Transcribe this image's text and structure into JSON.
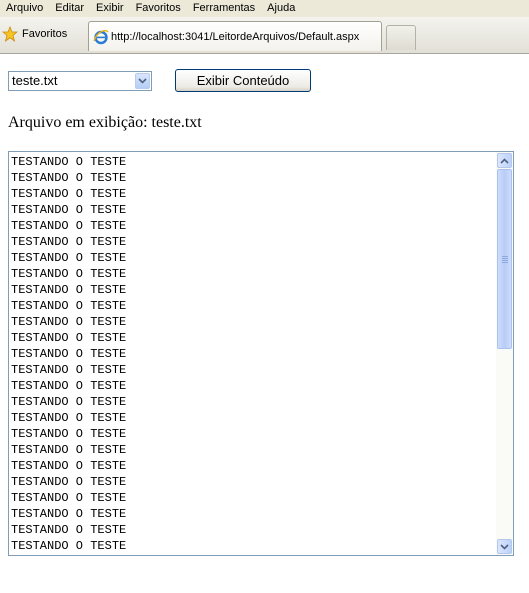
{
  "menu": [
    "Arquivo",
    "Editar",
    "Exibir",
    "Favoritos",
    "Ferramentas",
    "Ajuda"
  ],
  "favorites_label": "Favoritos",
  "tab": {
    "title": "http://localhost:3041/LeitordeArquivos/Default.aspx"
  },
  "file_select": {
    "value": "teste.txt"
  },
  "show_button": {
    "label": "Exibir Conteúdo"
  },
  "current_file": {
    "label": "Arquivo em exibição:",
    "name": "teste.txt"
  },
  "content_lines": [
    "TESTANDO O TESTE",
    "TESTANDO O TESTE",
    "TESTANDO O TESTE",
    "TESTANDO O TESTE",
    "TESTANDO O TESTE",
    "TESTANDO O TESTE",
    "TESTANDO O TESTE",
    "TESTANDO O TESTE",
    "TESTANDO O TESTE",
    "TESTANDO O TESTE",
    "TESTANDO O TESTE",
    "TESTANDO O TESTE",
    "TESTANDO O TESTE",
    "TESTANDO O TESTE",
    "TESTANDO O TESTE",
    "TESTANDO O TESTE",
    "TESTANDO O TESTE",
    "TESTANDO O TESTE",
    "TESTANDO O TESTE",
    "TESTANDO O TESTE",
    "TESTANDO O TESTE",
    "TESTANDO O TESTE",
    "TESTANDO O TESTE",
    "TESTANDO O TESTE",
    "TESTANDO O TESTE"
  ],
  "colors": {
    "chrome": "#ece9d8",
    "field_border": "#7f9db9",
    "button_border": "#003c74"
  }
}
